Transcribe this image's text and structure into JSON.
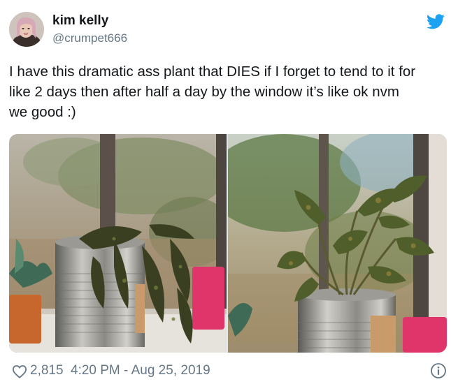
{
  "user": {
    "display_name": "kim kelly",
    "handle": "@crumpet666"
  },
  "tweet": {
    "lines": [
      "I have this dramatic ass plant that DIES if I forget to tend to it for",
      "like 2 days then after half a day by the window it’s like ok nvm",
      "we good :)"
    ]
  },
  "media": {
    "left_photo": "wilted-plant-in-tin-can",
    "right_photo": "revived-plant-in-tin-can"
  },
  "footer": {
    "likes": "2,815",
    "timestamp": "4:20 PM - Aug 25, 2019"
  },
  "icons": {
    "brand": "twitter-bird-icon",
    "like": "heart-icon",
    "info": "info-icon"
  },
  "colors": {
    "twitter_blue": "#1da1f2",
    "secondary_text": "#657786",
    "primary_text": "#14171a"
  }
}
